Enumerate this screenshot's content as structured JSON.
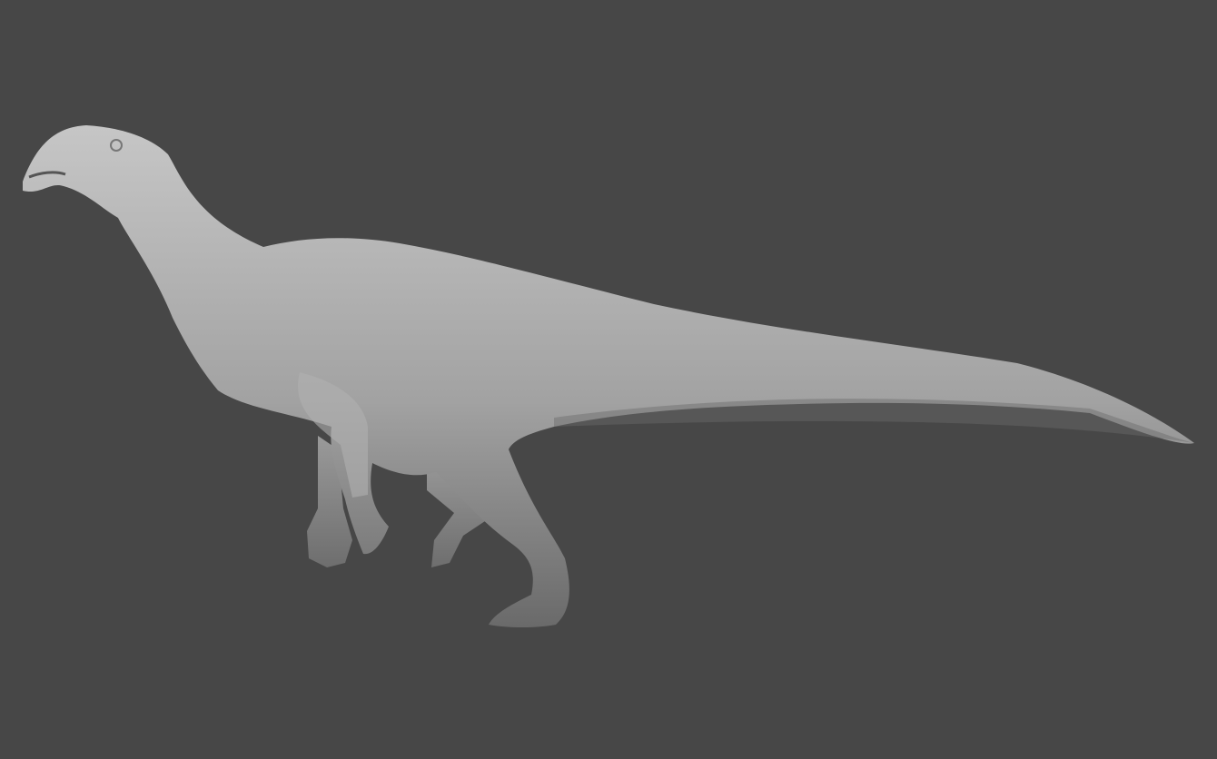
{
  "scene": {
    "subject": "dinosaur-sculpt",
    "colors": {
      "background": "#474747",
      "model_light": "#c4c4c4",
      "model_mid": "#9c9c9c",
      "model_dark": "#5e5e5e"
    }
  }
}
